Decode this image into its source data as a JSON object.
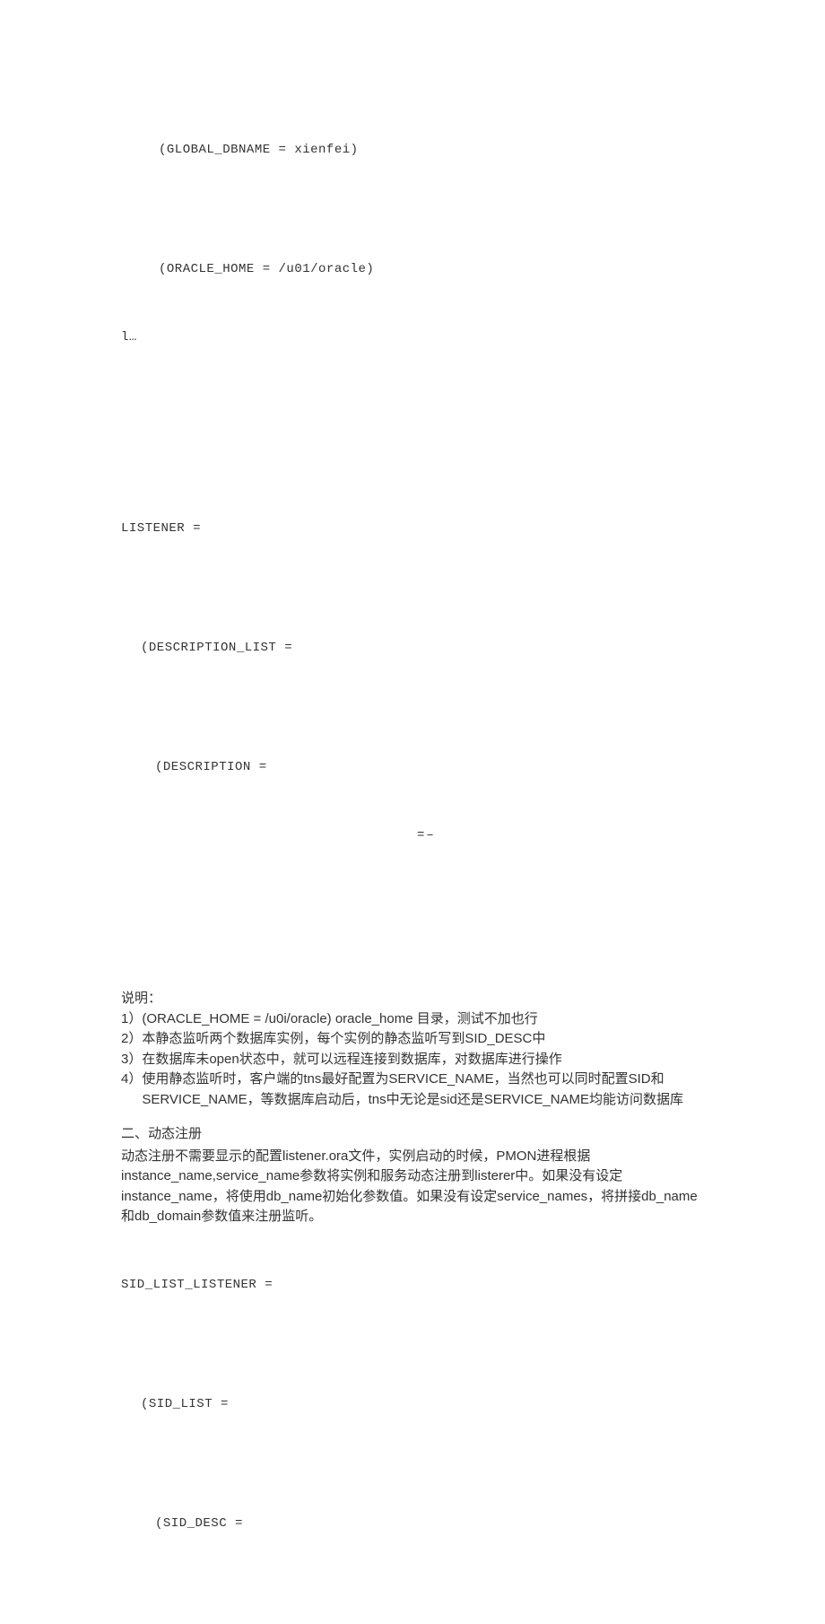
{
  "code1": {
    "l1": "(GLOBAL_DBNAME = xienfei)",
    "l2": "(ORACLE_HOME = /u01/oracle)"
  },
  "truncated": "l…",
  "code2": {
    "l1": "LISTENER =",
    "l2": "(DESCRIPTION_LIST =",
    "l3": "(DESCRIPTION ="
  },
  "marks": "=–",
  "explain": {
    "title": "说明：",
    "n1": "1）",
    "i1": "(ORACLE_HOME = /u0i/oracle) oracle_home 目录，测试不加也行",
    "n2": "2）",
    "i2": "本静态监听两个数据库实例，每个实例的静态监听写到SID_DESC中",
    "n3": "3）",
    "i3": "在数据库未open状态中，就可以远程连接到数据库，对数据库进行操作",
    "n4": "4）",
    "i4": "使用静态监听时，客户端的tns最好配置为SERVICE_NAME，当然也可以同时配置SID和SERVICE_NAME，等数据库启动后，tns中无论是sid还是SERVICE_NAME均能访问数据库"
  },
  "sec2": {
    "title": "二、动态注册",
    "p1": "动态注册不需要显示的配置listener.ora文件，实例启动的时候，PMON进程根据instance_name,service_name参数将实例和服务动态注册到listerer中。如果没有设定instance_name，将使用db_name初始化参数值。如果没有设定service_names，将拼接db_name和db_domain参数值来注册监听。"
  },
  "code3": {
    "l1": "SID_LIST_LISTENER =",
    "l2": "(SID_LIST =",
    "l3": "(SID_DESC ="
  }
}
